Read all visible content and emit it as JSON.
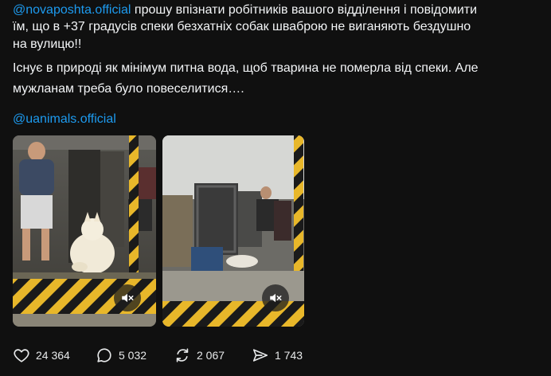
{
  "post": {
    "line1_mention": "@novaposhta.official",
    "line1_text": " прошу впізнати робітників вашого відділення і повідомити",
    "line2": "їм, що в +37 градусів спеки безхатніх собак шваброю не виганяють бездушно",
    "line3": "на вулицю!!",
    "line4": "Існує в природі як мінімум питна вода, щоб тварина не померла від спеки. Але",
    "line5": "мужланам треба було повеселитися….",
    "line6_mention": "@uanimals.official"
  },
  "media": {
    "videos": [
      {
        "muted_icon": "speaker-muted-icon"
      },
      {
        "muted_icon": "speaker-muted-icon"
      }
    ]
  },
  "actions": {
    "likes": "24 364",
    "replies": "5 032",
    "reposts": "2 067",
    "shares": "1 743"
  },
  "colors": {
    "background": "#101010",
    "text": "#f3f5f7",
    "link": "#1d9bf0",
    "hazard_yellow": "#e8b72a",
    "hazard_black": "#1a1a1a"
  }
}
